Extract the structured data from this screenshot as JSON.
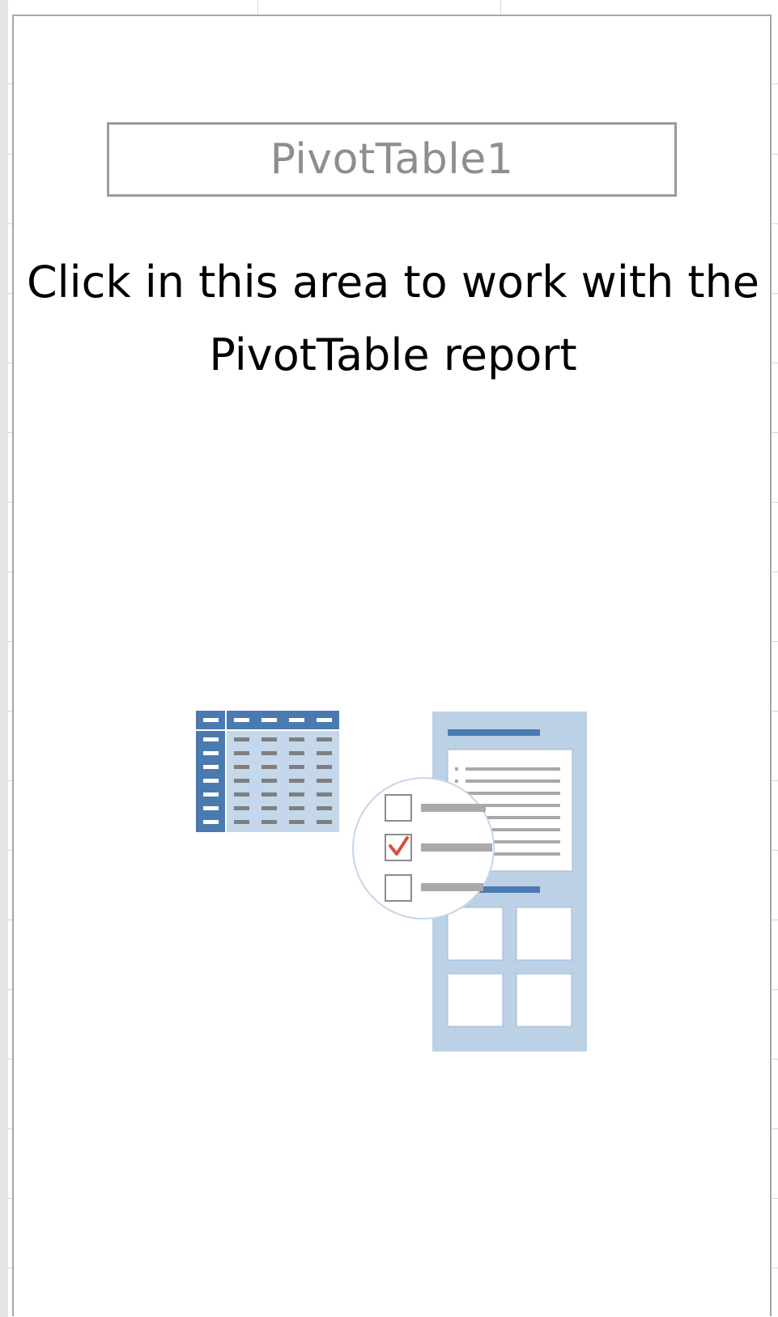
{
  "pivot": {
    "name": "PivotTable1",
    "instruction": "Click in this area to work with the PivotTable report"
  },
  "colors": {
    "header_blue": "#4a7ab0",
    "panel_blue": "#bcd0e6",
    "table_body": "#c5d7ea",
    "dash_gray": "#7f7f7f",
    "bar_gray": "#a9a9a9",
    "check_red": "#d8503a",
    "box_border": "#9b9b9b",
    "grid_border": "#a6a6a6"
  },
  "icons": {
    "illustration": "pivot-table-illustration",
    "checkbox_checked": "checkmark-icon"
  }
}
